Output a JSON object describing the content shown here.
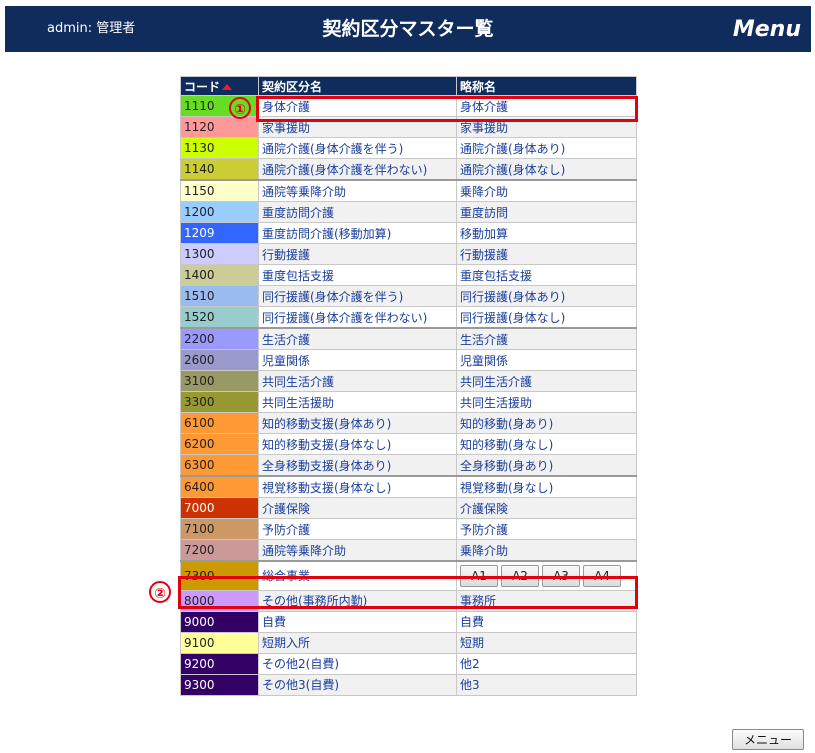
{
  "header": {
    "user": "admin: 管理者",
    "title": "契約区分マスター覧",
    "menu": "Menu"
  },
  "table": {
    "headers": {
      "code": "コード",
      "name": "契約区分名",
      "abbr": "略称名"
    },
    "rows": [
      {
        "code": "1110",
        "name": "身体介護",
        "abbr": "身体介護",
        "color": "#66dd22"
      },
      {
        "code": "1120",
        "name": "家事援助",
        "abbr": "家事援助",
        "color": "#ff9999"
      },
      {
        "code": "1130",
        "name": "通院介護(身体介護を伴う)",
        "abbr": "通院介護(身体あり)",
        "color": "#ccff00"
      },
      {
        "code": "1140",
        "name": "通院介護(身体介護を伴わない)",
        "abbr": "通院介護(身体なし)",
        "color": "#cccc33"
      },
      {
        "code": "1150",
        "name": "通院等乗降介助",
        "abbr": "乗降介助",
        "color": "#ffffcc"
      },
      {
        "code": "1200",
        "name": "重度訪問介護",
        "abbr": "重度訪問",
        "color": "#99ccff"
      },
      {
        "code": "1209",
        "name": "重度訪問介護(移動加算)",
        "abbr": "移動加算",
        "color": "#3366ff",
        "dark": true
      },
      {
        "code": "1300",
        "name": "行動援護",
        "abbr": "行動援護",
        "color": "#ccccff"
      },
      {
        "code": "1400",
        "name": "重度包括支援",
        "abbr": "重度包括支援",
        "color": "#cccc99"
      },
      {
        "code": "1510",
        "name": "同行援護(身体介護を伴う)",
        "abbr": "同行援護(身体あり)",
        "color": "#99bbee"
      },
      {
        "code": "1520",
        "name": "同行援護(身体介護を伴わない)",
        "abbr": "同行援護(身体なし)",
        "color": "#99cccc"
      },
      {
        "code": "2200",
        "name": "生活介護",
        "abbr": "生活介護",
        "color": "#9999ff"
      },
      {
        "code": "2600",
        "name": "児童関係",
        "abbr": "児童関係",
        "color": "#9999cc"
      },
      {
        "code": "3100",
        "name": "共同生活介護",
        "abbr": "共同生活介護",
        "color": "#999966"
      },
      {
        "code": "3300",
        "name": "共同生活援助",
        "abbr": "共同生活援助",
        "color": "#999933"
      },
      {
        "code": "6100",
        "name": "知的移動支援(身体あり)",
        "abbr": "知的移動(身あり)",
        "color": "#ff9933"
      },
      {
        "code": "6200",
        "name": "知的移動支援(身体なし)",
        "abbr": "知的移動(身なし)",
        "color": "#ff9933"
      },
      {
        "code": "6300",
        "name": "全身移動支援(身体あり)",
        "abbr": "全身移動(身あり)",
        "color": "#ff9933"
      },
      {
        "code": "6400",
        "name": "視覚移動支援(身体なし)",
        "abbr": "視覚移動(身なし)",
        "color": "#ff9933"
      },
      {
        "code": "7000",
        "name": "介護保険",
        "abbr": "介護保険",
        "color": "#cc3300",
        "dark": true
      },
      {
        "code": "7100",
        "name": "予防介護",
        "abbr": "予防介護",
        "color": "#cc9966"
      },
      {
        "code": "7200",
        "name": "通院等乗降介助",
        "abbr": "乗降介助",
        "color": "#cc9999"
      },
      {
        "code": "7300",
        "name": "総合事業",
        "abbr": "",
        "color": "#cc9900",
        "buttons": [
          "A1",
          "A2",
          "A3",
          "A4"
        ]
      },
      {
        "code": "8000",
        "name": "その他(事務所内勤)",
        "abbr": "事務所",
        "color": "#cc99ff"
      },
      {
        "code": "9000",
        "name": "自費",
        "abbr": "自費",
        "color": "#330066",
        "dark": true
      },
      {
        "code": "9100",
        "name": "短期入所",
        "abbr": "短期",
        "color": "#ffff99"
      },
      {
        "code": "9200",
        "name": "その他2(自費)",
        "abbr": "他2",
        "color": "#330066",
        "dark": true
      },
      {
        "code": "9300",
        "name": "その他3(自費)",
        "abbr": "他3",
        "color": "#330066",
        "dark": true
      }
    ]
  },
  "annotations": {
    "one": "①",
    "two": "②"
  },
  "footer": {
    "menu_button": "メニュー"
  }
}
